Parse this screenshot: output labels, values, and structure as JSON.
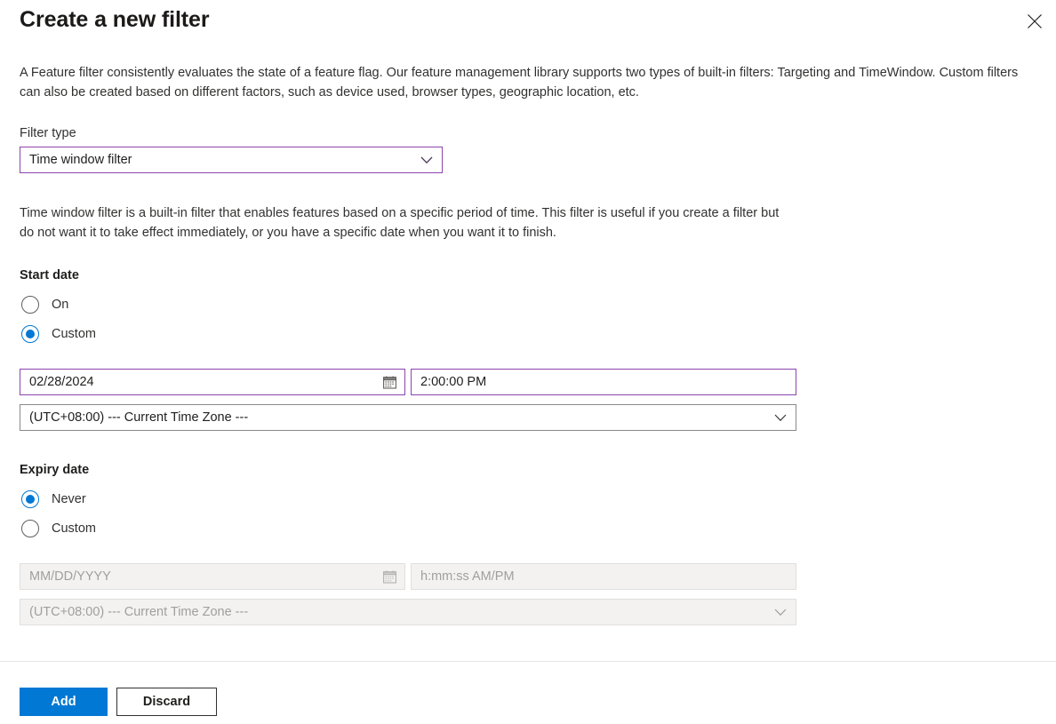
{
  "header": {
    "title": "Create a new filter",
    "close_icon": "close-icon"
  },
  "description": "A Feature filter consistently evaluates the state of a feature flag. Our feature management library supports two types of built-in filters: Targeting and TimeWindow. Custom filters can also be created based on different factors, such as device used, browser types, geographic location, etc.",
  "filter_type": {
    "label": "Filter type",
    "value": "Time window filter",
    "chevron_icon": "chevron-down-icon"
  },
  "filter_description": "Time window filter is a built-in filter that enables features based on a specific period of time. This filter is useful if you create a filter but do not want it to take effect immediately, or you have a specific date when you want it to finish.",
  "start_date": {
    "heading": "Start date",
    "options": [
      {
        "label": "On",
        "checked": false
      },
      {
        "label": "Custom",
        "checked": true
      }
    ],
    "date_value": "02/28/2024",
    "date_placeholder": "MM/DD/YYYY",
    "calendar_icon": "calendar-icon",
    "time_value": "2:00:00 PM",
    "time_placeholder": "h:mm:ss AM/PM",
    "timezone_value": "(UTC+08:00) --- Current Time Zone ---",
    "chevron_icon": "chevron-down-icon"
  },
  "expiry_date": {
    "heading": "Expiry date",
    "options": [
      {
        "label": "Never",
        "checked": true
      },
      {
        "label": "Custom",
        "checked": false
      }
    ],
    "date_value": "",
    "date_placeholder": "MM/DD/YYYY",
    "calendar_icon": "calendar-icon",
    "time_value": "",
    "time_placeholder": "h:mm:ss AM/PM",
    "timezone_value": "(UTC+08:00) --- Current Time Zone ---",
    "chevron_icon": "chevron-down-icon"
  },
  "footer": {
    "add_label": "Add",
    "discard_label": "Discard"
  },
  "colors": {
    "primary": "#0078d4",
    "focus_border": "#8e44ad",
    "neutral_border": "#8a8886",
    "disabled_bg": "#f3f2f1",
    "disabled_text": "#a19f9d"
  }
}
